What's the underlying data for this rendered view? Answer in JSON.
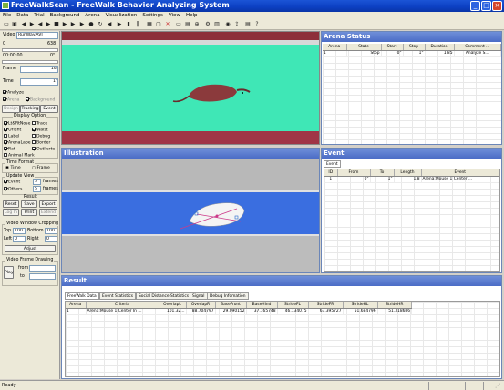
{
  "window": {
    "title": "FreeWalkScan - FreeWalk Behavior Analyzing System",
    "minimize": "_",
    "maximize": "□",
    "close": "×"
  },
  "menu": [
    "File",
    "Data",
    "Trial",
    "Background",
    "Arena",
    "Visualization",
    "Settings",
    "View",
    "Help"
  ],
  "toolbar_icons": [
    "open-icon",
    "save-icon",
    "play-icon",
    "rewind-icon",
    "forward-icon",
    "stop-icon",
    "step-icon",
    "end-icon",
    "record-icon"
  ],
  "left": {
    "video_label": "Video",
    "video_file": "RunWay.AVI",
    "frame_start": "0",
    "frame_end": "638",
    "time_start": "00:00:00",
    "time_end": "0\"",
    "frame_label": "Frame",
    "frame_value": "1st",
    "time_label": "Time",
    "time_value": "1\"",
    "analyze": "Analyze",
    "arena": "Arena",
    "background": "Background",
    "tab_design": "Design",
    "tab_tracking": "Tracking",
    "tab_event": "Event",
    "display_option": "Display Option",
    "opts": [
      [
        "Lt&RtNose",
        "on",
        "Trace",
        "off"
      ],
      [
        "Orient",
        "on",
        "Waist",
        "on"
      ],
      [
        "Label",
        "off",
        "Debug",
        "off"
      ],
      [
        "ArenaLabe",
        "on",
        "Border",
        "off"
      ],
      [
        "Rat",
        "on",
        "Outlierte",
        "on"
      ]
    ],
    "animal_mark": "Animal Mark",
    "time_format": "Time Format",
    "tf_time": "Time",
    "tf_frame": "Frame",
    "update_view": "Update View",
    "event": "Event",
    "event_n": "5",
    "others": "Others",
    "others_n": "5",
    "frames": "frames",
    "result": "Result",
    "reset": "Reset",
    "save": "Save",
    "export": "Export",
    "log_in": "Log In",
    "print": "Print",
    "extend": "Extend",
    "crop": "Video Window Cropping",
    "top": "Top",
    "top_v": "100",
    "bottom": "Bottom",
    "bottom_v": "100",
    "left_l": "Left",
    "left_v": "0",
    "right": "Right",
    "right_v": "0",
    "adjust": "Adjust",
    "drawing": "Video Frame Drawing",
    "play": "Play",
    "from": "from",
    "to": "to"
  },
  "arena_status": {
    "title": "Arena Status",
    "columns": [
      "Arena",
      "State",
      "Start",
      "Stop",
      "Duration",
      "Comment ..."
    ],
    "rows": [
      [
        "1",
        "Stop",
        "0\"",
        "1\"",
        "1.85",
        "Analyze S..."
      ]
    ]
  },
  "illustration": {
    "title": "Illustration"
  },
  "event_panel": {
    "title": "Event",
    "tab": "Event",
    "columns": [
      "ID",
      "From",
      "To",
      "Length",
      "Event"
    ],
    "rows": [
      [
        "1",
        "0\"",
        "1\"",
        "1.8",
        "Arena:Mouse 1 Center ..."
      ]
    ]
  },
  "result": {
    "title": "Result",
    "tabs": [
      "FreeWalk Data",
      "Event Statistics",
      "Social Distance Statistics",
      "Signal",
      "Debug Infomation"
    ],
    "columns": [
      "Arena",
      "Criteria",
      "OverlapL",
      "OverlapR",
      "BaseFront",
      "BaseHind",
      "StrideFL",
      "StrideFR",
      "StrideHL",
      "StrideHR"
    ],
    "rows": [
      [
        "1",
        "Arena:Mouse 1 Center In ...",
        "101.32...",
        "88.704797",
        "29.090152",
        "37.165748",
        "46.134075",
        "63.395727",
        "51.684796",
        "51.318686"
      ]
    ]
  },
  "status": "Ready",
  "colors": {
    "title": "#0c3fc2",
    "panel_header": "#5a7bd0",
    "arena_floor": "#3a6ee0"
  }
}
